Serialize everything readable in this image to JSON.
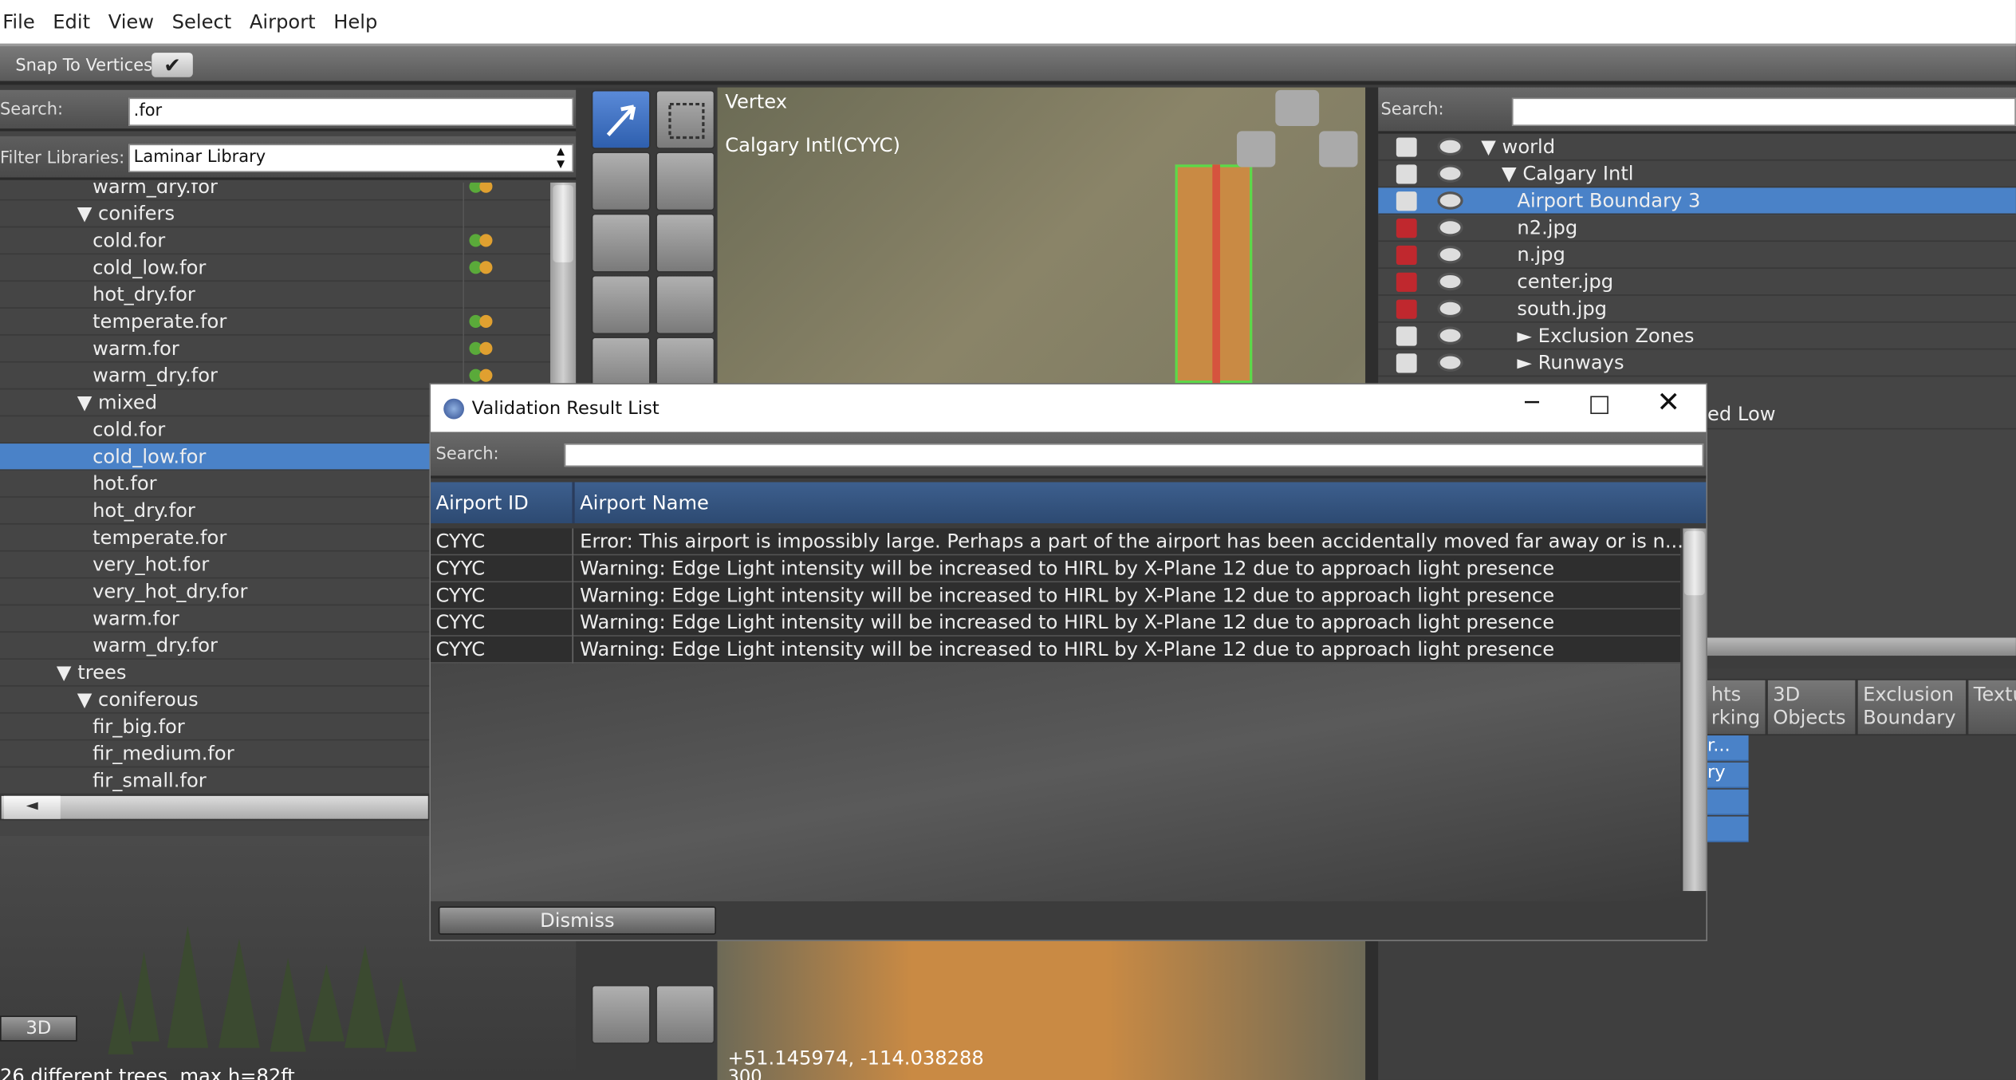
{
  "menu": [
    "File",
    "Edit",
    "View",
    "Select",
    "Airport",
    "Help"
  ],
  "toolbar": {
    "snap_label": "Snap To Vertices",
    "snap_check": "✔"
  },
  "library": {
    "search_label": "Search:",
    "search_value": ".for",
    "filter_label": "Filter Libraries:",
    "filter_value": "Laminar Library",
    "filter_arrow": "▲▼",
    "rows": [
      {
        "label": "warm_dry.for",
        "indent": 72,
        "leaf": true
      },
      {
        "label": "▼ conifers",
        "indent": 60,
        "leaf": false
      },
      {
        "label": "cold.for",
        "indent": 72,
        "leaf": true
      },
      {
        "label": "cold_low.for",
        "indent": 72,
        "leaf": true
      },
      {
        "label": "hot_dry.for",
        "indent": 72,
        "leaf": false
      },
      {
        "label": "temperate.for",
        "indent": 72,
        "leaf": true
      },
      {
        "label": "warm.for",
        "indent": 72,
        "leaf": true
      },
      {
        "label": "warm_dry.for",
        "indent": 72,
        "leaf": true
      },
      {
        "label": "▼ mixed",
        "indent": 60,
        "leaf": false
      },
      {
        "label": "cold.for",
        "indent": 72,
        "leaf": false
      },
      {
        "label": "cold_low.for",
        "indent": 72,
        "leaf": false,
        "selected": true
      },
      {
        "label": "hot.for",
        "indent": 72,
        "leaf": false
      },
      {
        "label": "hot_dry.for",
        "indent": 72,
        "leaf": false
      },
      {
        "label": "temperate.for",
        "indent": 72,
        "leaf": false
      },
      {
        "label": "very_hot.for",
        "indent": 72,
        "leaf": false
      },
      {
        "label": "very_hot_dry.for",
        "indent": 72,
        "leaf": false
      },
      {
        "label": "warm.for",
        "indent": 72,
        "leaf": false
      },
      {
        "label": "warm_dry.for",
        "indent": 72,
        "leaf": false
      },
      {
        "label": "▼ trees",
        "indent": 44,
        "leaf": false
      },
      {
        "label": "▼ coniferous",
        "indent": 60,
        "leaf": false
      },
      {
        "label": "fir_big.for",
        "indent": 72,
        "leaf": false
      },
      {
        "label": "fir_medium.for",
        "indent": 72,
        "leaf": false
      },
      {
        "label": "fir_small.for",
        "indent": 72,
        "leaf": false
      }
    ],
    "scroll_left": "◄",
    "preview_button": "3D",
    "preview_caption": "26 different trees, max h=82ft"
  },
  "map": {
    "tool_label": "Vertex",
    "airport_label": "Calgary Intl(CYYC)",
    "coords": "+51.145974, -114.038288",
    "scale_hint": "300"
  },
  "hierarchy": {
    "search_label": "Search:",
    "search_value": "",
    "rows": [
      {
        "label": "▼ world",
        "indent": 80,
        "lock": "open"
      },
      {
        "label": "▼ Calgary Intl",
        "indent": 96,
        "lock": "open"
      },
      {
        "label": "Airport Boundary 3",
        "indent": 108,
        "lock": "open",
        "selected": true
      },
      {
        "label": "n2.jpg",
        "indent": 108,
        "lock": "red"
      },
      {
        "label": "n.jpg",
        "indent": 108,
        "lock": "red"
      },
      {
        "label": "center.jpg",
        "indent": 108,
        "lock": "red"
      },
      {
        "label": "south.jpg",
        "indent": 108,
        "lock": "red"
      },
      {
        "label": "► Exclusion Zones",
        "indent": 108,
        "lock": "open"
      },
      {
        "label": "► Runways",
        "indent": 108,
        "lock": "open"
      }
    ],
    "partial_row": "ed Low"
  },
  "tabs": [
    {
      "label": "hts rking"
    },
    {
      "label": "3D Objects"
    },
    {
      "label": "Exclusion Boundary"
    },
    {
      "label": "Textu"
    }
  ],
  "props": [
    "r...",
    "ry",
    "",
    ""
  ],
  "dialog": {
    "title": "Validation Result List",
    "search_label": "Search:",
    "search_value": "",
    "col_id": "Airport ID",
    "col_name": "Airport Name",
    "rows": [
      {
        "id": "CYYC",
        "msg": "Error: This airport is impossibly large. Perhaps a part of the airport has been accidentally moved far away or is n..."
      },
      {
        "id": "CYYC",
        "msg": "Warning: Edge Light intensity will be increased to HIRL by X-Plane 12 due to approach light presence"
      },
      {
        "id": "CYYC",
        "msg": "Warning: Edge Light intensity will be increased to HIRL by X-Plane 12 due to approach light presence"
      },
      {
        "id": "CYYC",
        "msg": "Warning: Edge Light intensity will be increased to HIRL by X-Plane 12 due to approach light presence"
      },
      {
        "id": "CYYC",
        "msg": "Warning: Edge Light intensity will be increased to HIRL by X-Plane 12 due to approach light presence"
      }
    ],
    "dismiss": "Dismiss"
  }
}
